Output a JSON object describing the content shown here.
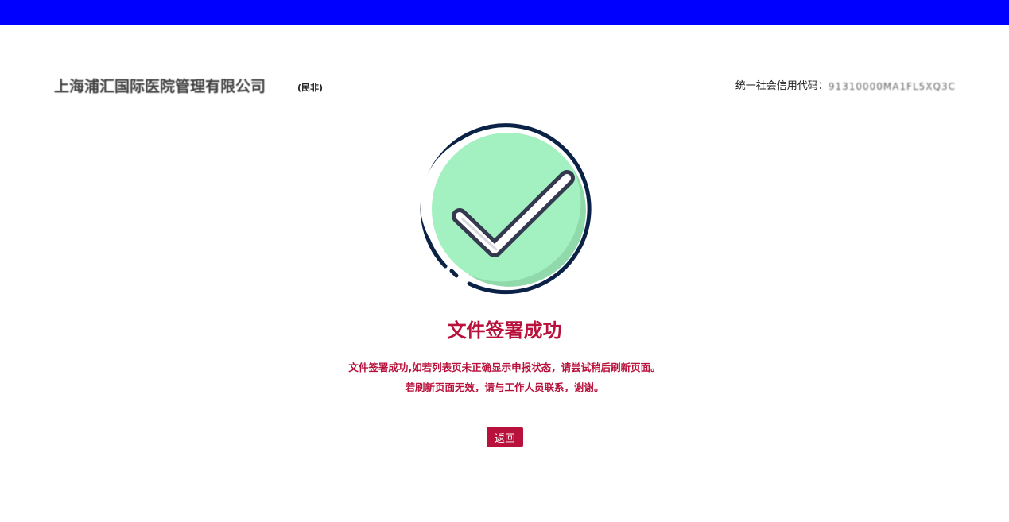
{
  "header": {
    "org_name": "上海浦汇国际医院管理有限公司",
    "org_type": "(民非)",
    "credit_label": "统一社会信用代码：",
    "credit_code": "91310000MA1FL5XQ3C"
  },
  "result": {
    "icon": "check-circle-icon",
    "title": "文件签署成功",
    "message_line1": "文件签署成功,如若列表页未正确显示申报状态，请尝试稍后刷新页面。",
    "message_line2": "若刷新页面无效，请与工作人员联系，谢谢。"
  },
  "actions": {
    "back_label": "返回"
  },
  "colors": {
    "top_bar": "#0000ff",
    "accent": "#b8113b",
    "circle_fill": "#a3f0c0",
    "circle_outline": "#0b2247"
  }
}
